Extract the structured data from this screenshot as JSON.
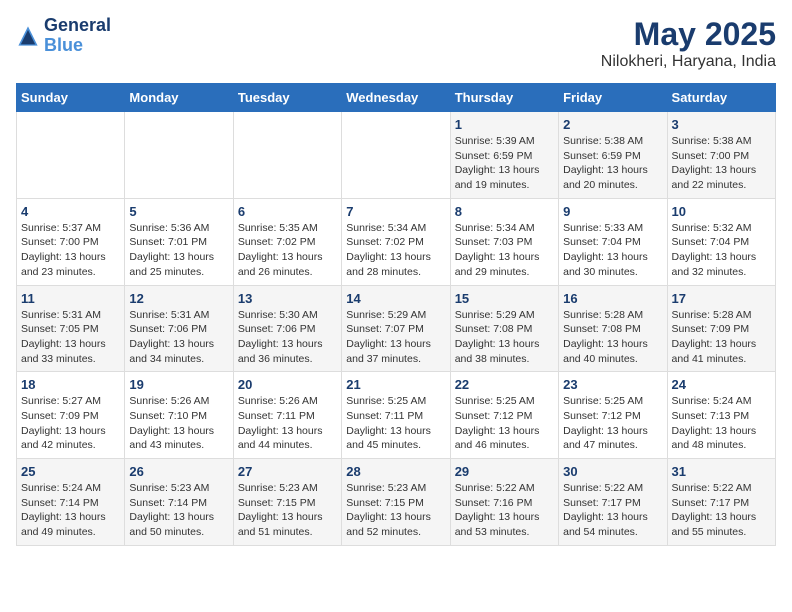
{
  "header": {
    "logo_line1": "General",
    "logo_line2": "Blue",
    "title": "May 2025",
    "subtitle": "Nilokheri, Haryana, India"
  },
  "weekdays": [
    "Sunday",
    "Monday",
    "Tuesday",
    "Wednesday",
    "Thursday",
    "Friday",
    "Saturday"
  ],
  "weeks": [
    [
      {
        "day": "",
        "info": ""
      },
      {
        "day": "",
        "info": ""
      },
      {
        "day": "",
        "info": ""
      },
      {
        "day": "",
        "info": ""
      },
      {
        "day": "1",
        "info": "Sunrise: 5:39 AM\nSunset: 6:59 PM\nDaylight: 13 hours\nand 19 minutes."
      },
      {
        "day": "2",
        "info": "Sunrise: 5:38 AM\nSunset: 6:59 PM\nDaylight: 13 hours\nand 20 minutes."
      },
      {
        "day": "3",
        "info": "Sunrise: 5:38 AM\nSunset: 7:00 PM\nDaylight: 13 hours\nand 22 minutes."
      }
    ],
    [
      {
        "day": "4",
        "info": "Sunrise: 5:37 AM\nSunset: 7:00 PM\nDaylight: 13 hours\nand 23 minutes."
      },
      {
        "day": "5",
        "info": "Sunrise: 5:36 AM\nSunset: 7:01 PM\nDaylight: 13 hours\nand 25 minutes."
      },
      {
        "day": "6",
        "info": "Sunrise: 5:35 AM\nSunset: 7:02 PM\nDaylight: 13 hours\nand 26 minutes."
      },
      {
        "day": "7",
        "info": "Sunrise: 5:34 AM\nSunset: 7:02 PM\nDaylight: 13 hours\nand 28 minutes."
      },
      {
        "day": "8",
        "info": "Sunrise: 5:34 AM\nSunset: 7:03 PM\nDaylight: 13 hours\nand 29 minutes."
      },
      {
        "day": "9",
        "info": "Sunrise: 5:33 AM\nSunset: 7:04 PM\nDaylight: 13 hours\nand 30 minutes."
      },
      {
        "day": "10",
        "info": "Sunrise: 5:32 AM\nSunset: 7:04 PM\nDaylight: 13 hours\nand 32 minutes."
      }
    ],
    [
      {
        "day": "11",
        "info": "Sunrise: 5:31 AM\nSunset: 7:05 PM\nDaylight: 13 hours\nand 33 minutes."
      },
      {
        "day": "12",
        "info": "Sunrise: 5:31 AM\nSunset: 7:06 PM\nDaylight: 13 hours\nand 34 minutes."
      },
      {
        "day": "13",
        "info": "Sunrise: 5:30 AM\nSunset: 7:06 PM\nDaylight: 13 hours\nand 36 minutes."
      },
      {
        "day": "14",
        "info": "Sunrise: 5:29 AM\nSunset: 7:07 PM\nDaylight: 13 hours\nand 37 minutes."
      },
      {
        "day": "15",
        "info": "Sunrise: 5:29 AM\nSunset: 7:08 PM\nDaylight: 13 hours\nand 38 minutes."
      },
      {
        "day": "16",
        "info": "Sunrise: 5:28 AM\nSunset: 7:08 PM\nDaylight: 13 hours\nand 40 minutes."
      },
      {
        "day": "17",
        "info": "Sunrise: 5:28 AM\nSunset: 7:09 PM\nDaylight: 13 hours\nand 41 minutes."
      }
    ],
    [
      {
        "day": "18",
        "info": "Sunrise: 5:27 AM\nSunset: 7:09 PM\nDaylight: 13 hours\nand 42 minutes."
      },
      {
        "day": "19",
        "info": "Sunrise: 5:26 AM\nSunset: 7:10 PM\nDaylight: 13 hours\nand 43 minutes."
      },
      {
        "day": "20",
        "info": "Sunrise: 5:26 AM\nSunset: 7:11 PM\nDaylight: 13 hours\nand 44 minutes."
      },
      {
        "day": "21",
        "info": "Sunrise: 5:25 AM\nSunset: 7:11 PM\nDaylight: 13 hours\nand 45 minutes."
      },
      {
        "day": "22",
        "info": "Sunrise: 5:25 AM\nSunset: 7:12 PM\nDaylight: 13 hours\nand 46 minutes."
      },
      {
        "day": "23",
        "info": "Sunrise: 5:25 AM\nSunset: 7:12 PM\nDaylight: 13 hours\nand 47 minutes."
      },
      {
        "day": "24",
        "info": "Sunrise: 5:24 AM\nSunset: 7:13 PM\nDaylight: 13 hours\nand 48 minutes."
      }
    ],
    [
      {
        "day": "25",
        "info": "Sunrise: 5:24 AM\nSunset: 7:14 PM\nDaylight: 13 hours\nand 49 minutes."
      },
      {
        "day": "26",
        "info": "Sunrise: 5:23 AM\nSunset: 7:14 PM\nDaylight: 13 hours\nand 50 minutes."
      },
      {
        "day": "27",
        "info": "Sunrise: 5:23 AM\nSunset: 7:15 PM\nDaylight: 13 hours\nand 51 minutes."
      },
      {
        "day": "28",
        "info": "Sunrise: 5:23 AM\nSunset: 7:15 PM\nDaylight: 13 hours\nand 52 minutes."
      },
      {
        "day": "29",
        "info": "Sunrise: 5:22 AM\nSunset: 7:16 PM\nDaylight: 13 hours\nand 53 minutes."
      },
      {
        "day": "30",
        "info": "Sunrise: 5:22 AM\nSunset: 7:17 PM\nDaylight: 13 hours\nand 54 minutes."
      },
      {
        "day": "31",
        "info": "Sunrise: 5:22 AM\nSunset: 7:17 PM\nDaylight: 13 hours\nand 55 minutes."
      }
    ]
  ]
}
